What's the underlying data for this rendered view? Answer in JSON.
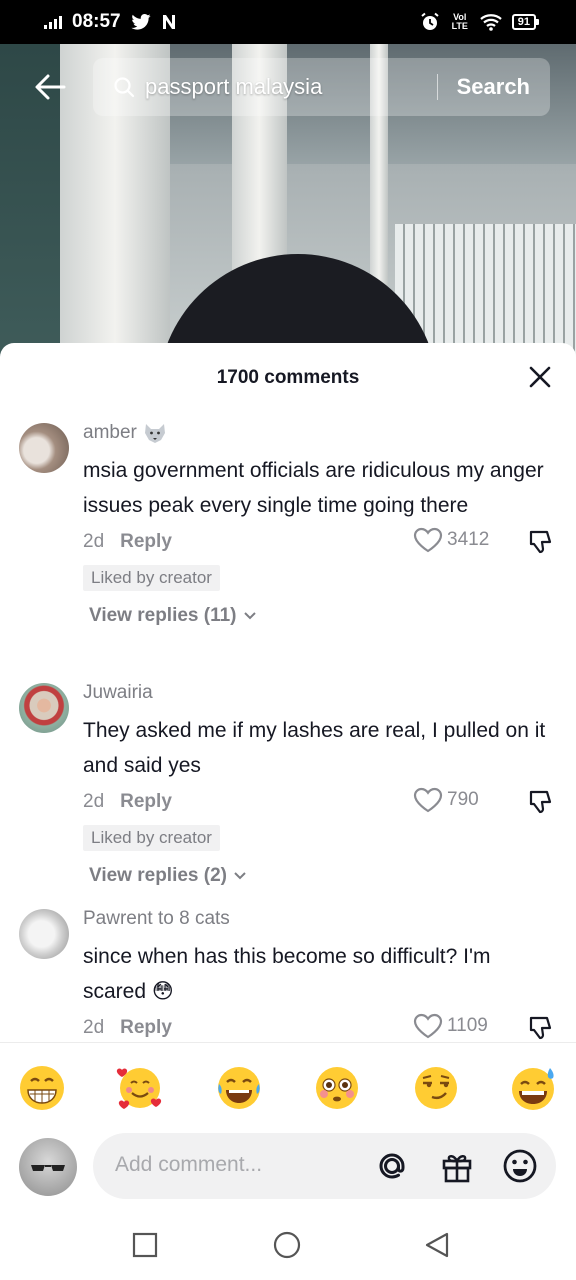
{
  "status_bar": {
    "time": "08:57",
    "lte_label": "Vol LTE",
    "battery": "91"
  },
  "search": {
    "query": "passport malaysia",
    "button_label": "Search"
  },
  "comments_header": {
    "count_label": "1700 comments"
  },
  "comments": [
    {
      "username": "amber",
      "text": "msia government officials are ridiculous my anger issues peak every single time going there",
      "date": "2d",
      "reply_label": "Reply",
      "likes": "3412",
      "badge": "Liked by creator",
      "view_replies": "View replies (11)"
    },
    {
      "username": "Juwairia",
      "text": "They asked me if my lashes are real, I pulled on it and said yes",
      "date": "2d",
      "reply_label": "Reply",
      "likes": "790",
      "badge": "Liked by creator",
      "view_replies": "View replies (2)"
    },
    {
      "username": "Pawrent to 8 cats",
      "text": "since when has this become so difficult? I'm scared 😳",
      "date": "2d",
      "reply_label": "Reply",
      "likes": "1109"
    }
  ],
  "emoji_bar": [
    "grinning-face",
    "smiling-face-with-hearts",
    "tears-of-joy",
    "flushed-face",
    "smirking-face",
    "grinning-sweat"
  ],
  "composer": {
    "placeholder": "Add comment..."
  },
  "colors": {
    "text": "#161823",
    "muted": "#8a8b91",
    "badge_bg": "#f1f1f2",
    "sheet_bg": "#ffffff"
  }
}
